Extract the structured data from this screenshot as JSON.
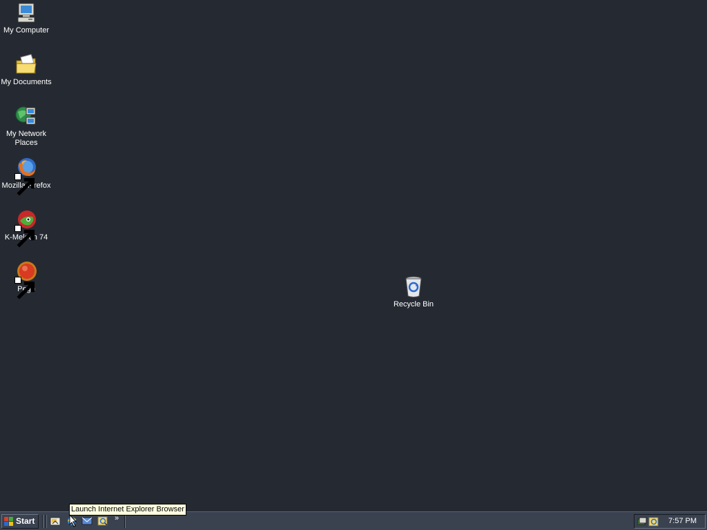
{
  "desktop": {
    "background_color": "#252a32",
    "icons": [
      {
        "label": "My Computer",
        "icon": "computer-icon"
      },
      {
        "label": "My Documents",
        "icon": "folder-icon"
      },
      {
        "label": "My Network Places",
        "icon": "network-places-icon"
      },
      {
        "label": "Mozilla Firefox",
        "icon": "firefox-icon"
      },
      {
        "label": "K-Meleon 74",
        "icon": "kmeleon-icon"
      },
      {
        "label": "Pego",
        "icon": "pego-icon"
      },
      {
        "label": "Recycle Bin",
        "icon": "recycle-bin-icon"
      }
    ]
  },
  "taskbar": {
    "start_label": "Start",
    "quick_launch": [
      {
        "icon": "show-desktop-icon"
      },
      {
        "icon": "internet-explorer-icon"
      },
      {
        "icon": "outlook-express-icon"
      },
      {
        "icon": "search-icon"
      }
    ],
    "more_label": "»",
    "clock": "7:57 PM"
  },
  "tooltip": {
    "text": "Launch Internet Explorer Browser"
  }
}
